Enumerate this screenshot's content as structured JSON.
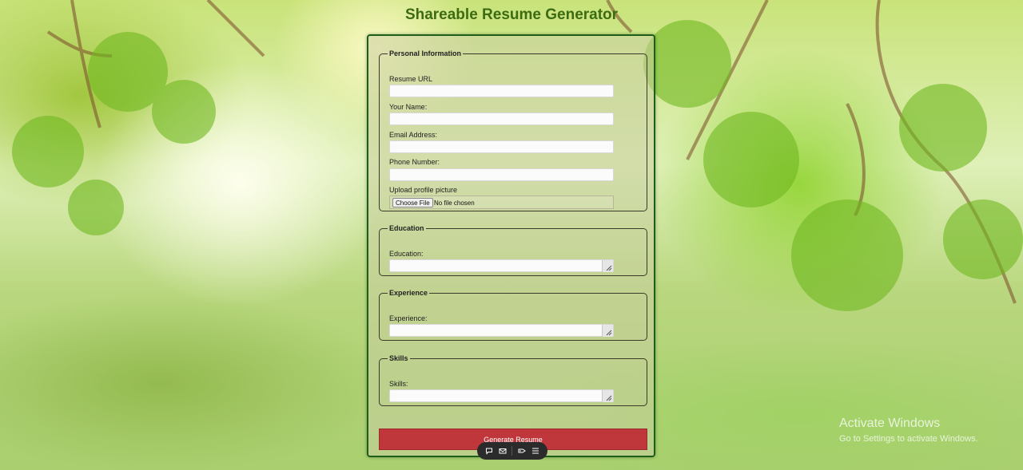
{
  "page": {
    "title": "Shareable Resume Generator"
  },
  "personal": {
    "legend": "Personal Information",
    "resume_url_label": "Resume URL",
    "name_label": "Your Name:",
    "email_label": "Email Address:",
    "phone_label": "Phone Number:",
    "picture_label": "Upload profile picture",
    "choose_file_label": "Choose File",
    "no_file_text": "No file chosen"
  },
  "education": {
    "legend": "Education",
    "label": "Education:"
  },
  "experience": {
    "legend": "Experience",
    "label": "Experience:"
  },
  "skills": {
    "legend": "Skills",
    "label": "Skills:"
  },
  "actions": {
    "generate_label": "Generate Resume"
  },
  "toolbar": {
    "icons": [
      "chat-bubble-icon",
      "mail-icon",
      "tag-icon",
      "menu-icon"
    ]
  },
  "watermark": {
    "title": "Activate Windows",
    "subtitle": "Go to Settings to activate Windows."
  },
  "colors": {
    "title": "#3c6b12",
    "card_border": "#1f5e1a",
    "generate_button": "#c0373b"
  }
}
